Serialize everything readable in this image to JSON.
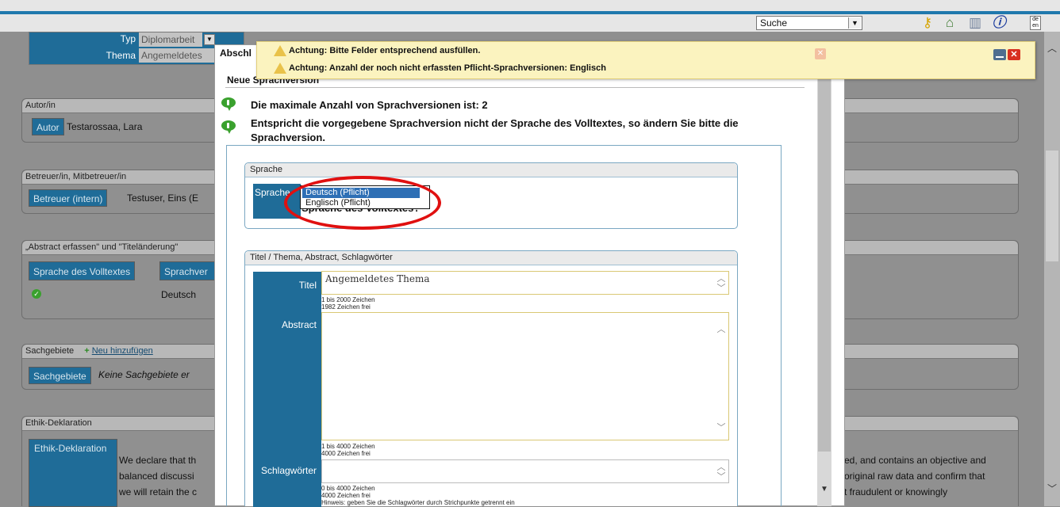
{
  "topbar": {
    "search_select": "Suche",
    "lang_icon_top": "de",
    "lang_icon_bottom": "en",
    "icons": [
      "key-icon",
      "home-icon",
      "library-icon",
      "info-icon"
    ]
  },
  "form": {
    "typ_label": "Typ",
    "typ_value": "Diplomarbeit",
    "thema_label": "Thema",
    "thema_value": "Angemeldetes",
    "autor_section": "Autor/in",
    "autor_label": "Autor",
    "autor_value": "Testarossaa, Lara",
    "betreuer_section": "Betreuer/in, Mitbetreuer/in",
    "betreuer_label": "Betreuer (intern)",
    "betreuer_value": "Testuser, Eins (E",
    "abstract_section": "„Abstract erfassen\" und \"Titeländerung\"",
    "col_sprache": "Sprache des Volltextes",
    "col_sprachver": "Sprachver",
    "row_sprache": "Deutsch",
    "sachgebiete_section": "Sachgebiete",
    "neu_hinzufuegen": "Neu hinzufügen",
    "sachgebiete_label": "Sachgebiete",
    "sachgebiete_value": "Keine Sachgebiete er",
    "ethik_section": "Ethik-Deklaration",
    "ethik_label": "Ethik-Deklaration",
    "ethik_line1_left": "We declare that th",
    "ethik_line2_left": "balanced discussi",
    "ethik_line3_left": "we will retain the c",
    "ethik_line1_right": "ed, and contains an objective and",
    "ethik_line2_right": "original raw data and confirm that",
    "ethik_line3_right": "t fraudulent or knowingly"
  },
  "notification": {
    "line1": "Achtung: Bitte Felder entsprechend ausfüllen.",
    "line2": "Achtung: Anzahl der noch nicht erfassten Pflicht-Sprachversionen: Englisch"
  },
  "modal": {
    "tab_label": "Abschl",
    "title": "Neue Sprachversion",
    "info1": "Die maximale Anzahl von Sprachversionen ist: 2",
    "info2_line1": "Entspricht die vorgegebene Sprachversion nicht der Sprache des Volltextes, so ändern Sie bitte die",
    "info2_line2": "Sprachversion.",
    "sprache_section": "Sprache",
    "sprache_label": "Sprache",
    "sprache_options": [
      "Deutsch (Pflicht)",
      "Englisch (Pflicht)"
    ],
    "sprache_question": "Sprache des Volltextes?",
    "titel_section": "Titel / Thema, Abstract, Schlagwörter",
    "titel_label": "Titel",
    "titel_value": "Angemeldetes Thema",
    "titel_limit": "1 bis 2000 Zeichen",
    "titel_free": "1982 Zeichen frei",
    "abstract_label": "Abstract",
    "abstract_value": "",
    "abstract_limit": "1 bis 4000 Zeichen",
    "abstract_free": "4000 Zeichen frei",
    "schlag_label": "Schlagwörter",
    "schlag_value": "",
    "schlag_limit": "0 bis 4000 Zeichen",
    "schlag_free": "4000 Zeichen frei",
    "schlag_hint": "Hinweis: geben Sie die Schlagwörter durch Strichpunkte getrennt ein"
  },
  "colors": {
    "accent_blue": "#1f6c98",
    "highlight_red": "#e01010",
    "notice_yellow": "#fbf3bf",
    "info_green": "#3aa12e"
  }
}
